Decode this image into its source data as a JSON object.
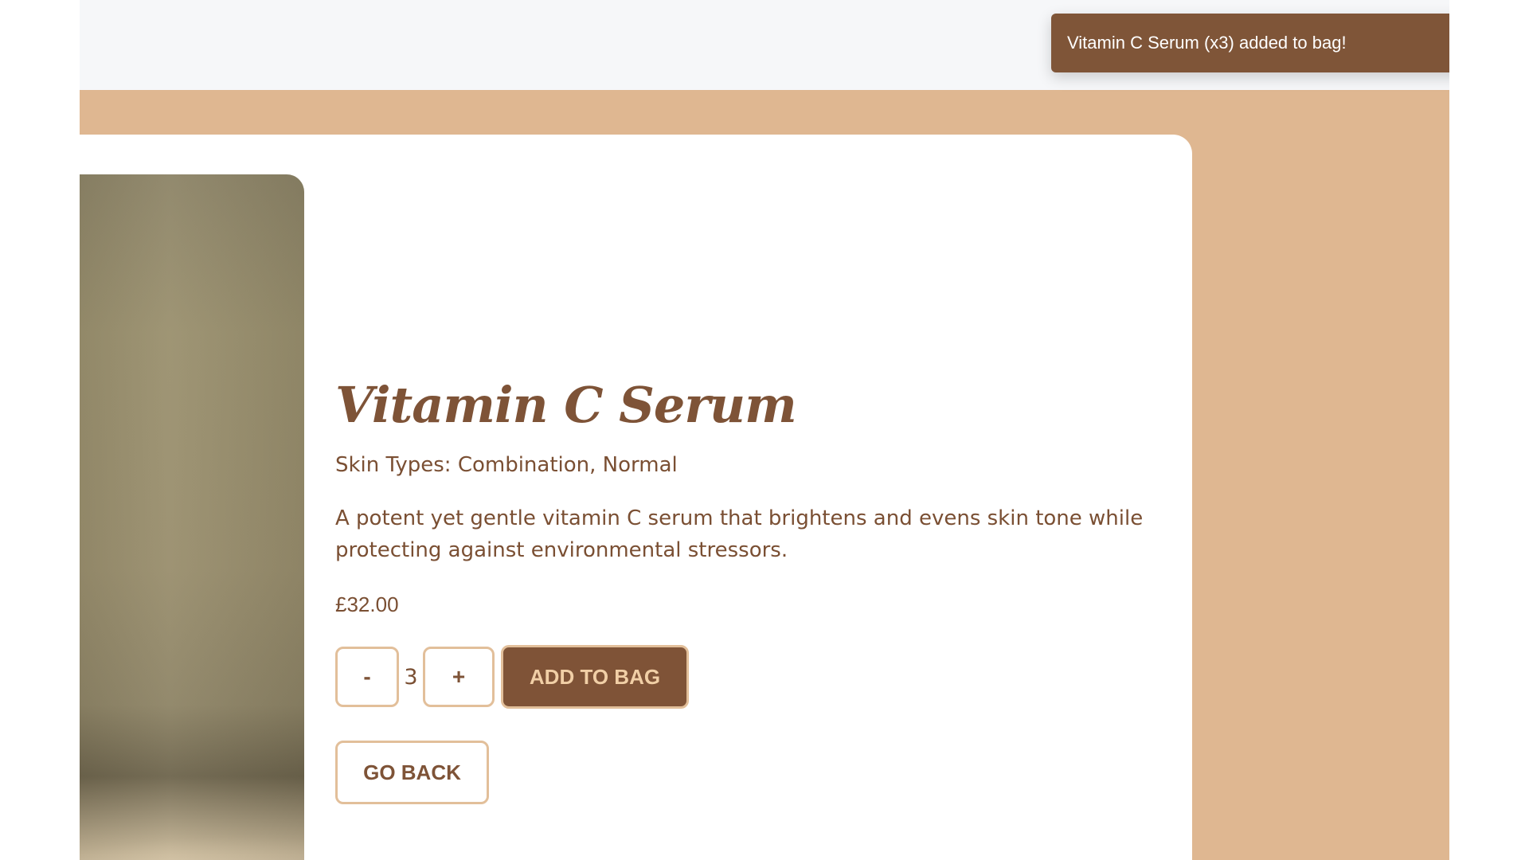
{
  "toast": {
    "message": "Vitamin C Serum (x3) added to bag!",
    "close_icon": "close-icon"
  },
  "product": {
    "title": "Vitamin C Serum",
    "skin_types": "Skin Types: Combination, Normal",
    "description": "A potent yet gentle vitamin C serum that brightens and evens skin tone while protecting against environmental stressors.",
    "price": "£32.00",
    "image_icon": "product-photo"
  },
  "quantity": {
    "decrement_label": "-",
    "value": "3",
    "increment_label": "+"
  },
  "actions": {
    "add_to_bag_label": "ADD TO BAG",
    "go_back_label": "GO BACK"
  },
  "colors": {
    "accent_brown": "#7f5337",
    "sand_background": "#dfb791",
    "border_tan": "#e2bf9a",
    "top_bar": "#f6f7f9"
  }
}
